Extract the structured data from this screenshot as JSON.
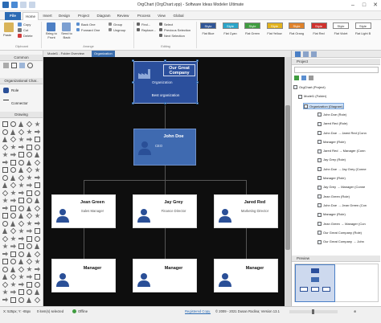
{
  "window": {
    "title": "OrgChart (OrgChart.vpp) - Software Ideas Modeler Ultimate"
  },
  "menu": {
    "tabs": [
      "File",
      "Home",
      "Insert",
      "Design",
      "Project",
      "Diagram",
      "Review",
      "Process",
      "View",
      "Global"
    ]
  },
  "ribbon": {
    "clipboard": {
      "paste": "Paste",
      "copy": "Copy",
      "cut": "Cut",
      "delete": "Delete",
      "group": "Clipboard"
    },
    "arrange": {
      "bring_front": "Bring to Front",
      "send_back": "Send to Back",
      "back_one": "Back One",
      "forward_one": "Forward One",
      "group": "Group",
      "ungroup": "Ungroup",
      "group_label": "Arrange"
    },
    "editing": {
      "find": "Find...",
      "replace": "Replace...",
      "select": "Select",
      "prev_sel": "Previous Selection",
      "next_sel": "Next Selection",
      "group": "Editing"
    },
    "styles": [
      {
        "label": "Flat Blue",
        "color": "#2f5597"
      },
      {
        "label": "Flat Cyan",
        "color": "#2aa5c9"
      },
      {
        "label": "Flat Green",
        "color": "#3f9c3f"
      },
      {
        "label": "Flat Yellow",
        "color": "#e2b21d"
      },
      {
        "label": "Flat Orang",
        "color": "#e0822a"
      },
      {
        "label": "Flat Red",
        "color": "#d0312d"
      },
      {
        "label": "Flat Violet",
        "color": "#ffffff"
      },
      {
        "label": "Flat Light B",
        "color": "#ffffff"
      }
    ],
    "style_label": "Style"
  },
  "doc_tabs": [
    "Model1 - Folder Overview",
    "Organization"
  ],
  "left_panel": {
    "common_header": "Common",
    "org_header": "Organizational Char..",
    "items": [
      "Role",
      "Connector"
    ],
    "drawing_header": "Drawing"
  },
  "chart": {
    "company": {
      "name": "Our Great Company",
      "type": "Organization",
      "desc": "Best organization"
    },
    "ceo": {
      "name": "John Doe",
      "role": "CEO"
    },
    "mid": [
      {
        "name": "Jean Green",
        "role": "Sales Manager"
      },
      {
        "name": "Jay Grey",
        "role": "Finance Director"
      },
      {
        "name": "Jared Red",
        "role": "Marketing Director"
      }
    ],
    "low": [
      {
        "name": "Manager"
      },
      {
        "name": "Manager"
      },
      {
        "name": "Manager"
      }
    ]
  },
  "right_panel": {
    "project_header": "Project",
    "preview_header": "Preview",
    "tree": [
      {
        "text": "OrgChart (Project)",
        "indent": 0
      },
      {
        "text": "Model1 (Folder)",
        "indent": 1
      },
      {
        "text": "Organization (Diagram)",
        "indent": 2,
        "selected": true
      },
      {
        "text": "John Doe (Role)",
        "indent": 3
      },
      {
        "text": "Jared Red (Role)",
        "indent": 3
      },
      {
        "text": "John Doe → Jared Red (Conn",
        "indent": 3
      },
      {
        "text": "Manager (Role)",
        "indent": 3
      },
      {
        "text": "Jared Red → Manager (Conn",
        "indent": 3
      },
      {
        "text": "Jay Grey (Role)",
        "indent": 3
      },
      {
        "text": "John Doe → Jay Grey (Conne",
        "indent": 3
      },
      {
        "text": "Manager (Role)",
        "indent": 3
      },
      {
        "text": "Jay Grey → Manager (Conne",
        "indent": 3
      },
      {
        "text": "Jean Green (Role)",
        "indent": 3
      },
      {
        "text": "John Doe → Jean Green (Con",
        "indent": 3
      },
      {
        "text": "Manager (Role)",
        "indent": 3
      },
      {
        "text": "Jean Green → Manager (Con",
        "indent": 3
      },
      {
        "text": "Our Great Company (Role)",
        "indent": 3
      },
      {
        "text": "Our Great Company → John",
        "indent": 3
      }
    ]
  },
  "status": {
    "coords": "X: 525px; Y: -65px",
    "selection": "0 item(s) selected",
    "offline": "Offline",
    "registered": "Registered Copy.",
    "copyright": "© 2009 - 2021 Dusan Rodina; Version 13.1"
  },
  "colors": {
    "accent": "#2b6bb4",
    "company_box": "#2b4f9c",
    "ceo_box": "#3f6ab0",
    "person_icon": "#2a4f97"
  }
}
